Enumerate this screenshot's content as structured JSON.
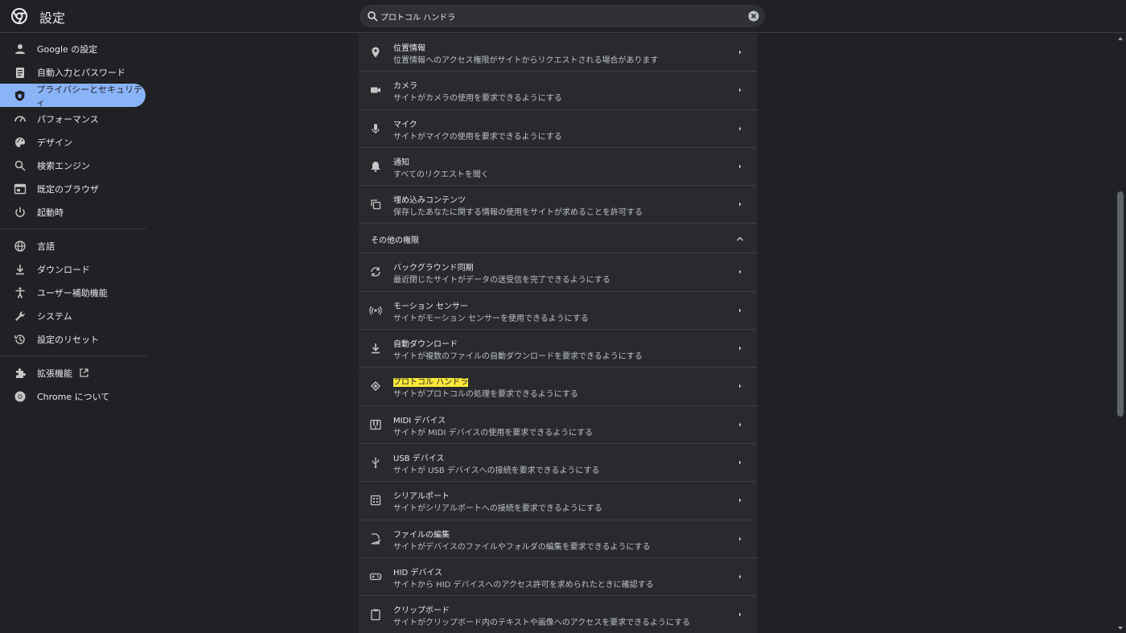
{
  "app": {
    "title": "設定"
  },
  "search": {
    "value": "プロトコル ハンドラ"
  },
  "sidebar": {
    "group1": [
      {
        "label": "Google の設定",
        "icon": "person-icon"
      },
      {
        "label": "自動入力とパスワード",
        "icon": "clipboard-icon"
      },
      {
        "label": "プライバシーとセキュリティ",
        "icon": "shield-icon",
        "active": true
      },
      {
        "label": "パフォーマンス",
        "icon": "speedometer-icon"
      },
      {
        "label": "デザイン",
        "icon": "palette-icon"
      },
      {
        "label": "検索エンジン",
        "icon": "search-icon"
      },
      {
        "label": "既定のブラウザ",
        "icon": "browser-icon"
      },
      {
        "label": "起動時",
        "icon": "power-icon"
      }
    ],
    "group2": [
      {
        "label": "言語",
        "icon": "globe-icon"
      },
      {
        "label": "ダウンロード",
        "icon": "download-icon"
      },
      {
        "label": "ユーザー補助機能",
        "icon": "accessibility-icon"
      },
      {
        "label": "システム",
        "icon": "wrench-icon"
      },
      {
        "label": "設定のリセット",
        "icon": "history-icon"
      }
    ],
    "group3": [
      {
        "label": "拡張機能",
        "icon": "puzzle-icon",
        "external": true
      },
      {
        "label": "Chrome について",
        "icon": "chrome-icon"
      }
    ]
  },
  "permissions_top": [
    {
      "title": "位置情報",
      "subtitle": "位置情報へのアクセス権限がサイトからリクエストされる場合があります",
      "icon": "location-icon"
    },
    {
      "title": "カメラ",
      "subtitle": "サイトがカメラの使用を要求できるようにする",
      "icon": "camera-icon"
    },
    {
      "title": "マイク",
      "subtitle": "サイトがマイクの使用を要求できるようにする",
      "icon": "mic-icon"
    },
    {
      "title": "通知",
      "subtitle": "すべてのリクエストを聞く",
      "icon": "bell-icon"
    },
    {
      "title": "埋め込みコンテンツ",
      "subtitle": "保存したあなたに関する情報の使用をサイトが求めることを許可する",
      "icon": "embed-icon"
    }
  ],
  "section": {
    "title": "その他の権限"
  },
  "permissions_more": [
    {
      "title": "バックグラウンド同期",
      "subtitle": "最近閉じたサイトがデータの送受信を完了できるようにする",
      "icon": "sync-icon"
    },
    {
      "title": "モーション センサー",
      "subtitle": "サイトがモーション センサーを使用できるようにする",
      "icon": "sensor-icon"
    },
    {
      "title": "自動ダウンロード",
      "subtitle": "サイトが複数のファイルの自動ダウンロードを要求できるようにする",
      "icon": "download-icon"
    },
    {
      "title": "プロトコル ハンドラ",
      "subtitle": "サイトがプロトコルの処理を要求できるようにする",
      "icon": "protocol-icon",
      "highlight": true
    },
    {
      "title": "MIDI デバイス",
      "subtitle": "サイトが MIDI デバイスの使用を要求できるようにする",
      "icon": "piano-icon"
    },
    {
      "title": "USB デバイス",
      "subtitle": "サイトが USB デバイスへの接続を要求できるようにする",
      "icon": "usb-icon"
    },
    {
      "title": "シリアルポート",
      "subtitle": "サイトがシリアルポートへの接続を要求できるようにする",
      "icon": "serial-icon"
    },
    {
      "title": "ファイルの編集",
      "subtitle": "サイトがデバイスのファイルやフォルダの編集を要求できるようにする",
      "icon": "file-edit-icon"
    },
    {
      "title": "HID デバイス",
      "subtitle": "サイトから HID デバイスへのアクセス許可を求められたときに確認する",
      "icon": "gamepad-icon"
    },
    {
      "title": "クリップボード",
      "subtitle": "サイトがクリップボード内のテキストや画像へのアクセスを要求できるようにする",
      "icon": "clipboard-icon"
    }
  ],
  "colors": {
    "accent": "#8ab4f8",
    "highlight": "#fce83a",
    "background": "#202124",
    "card": "#292a2d"
  }
}
